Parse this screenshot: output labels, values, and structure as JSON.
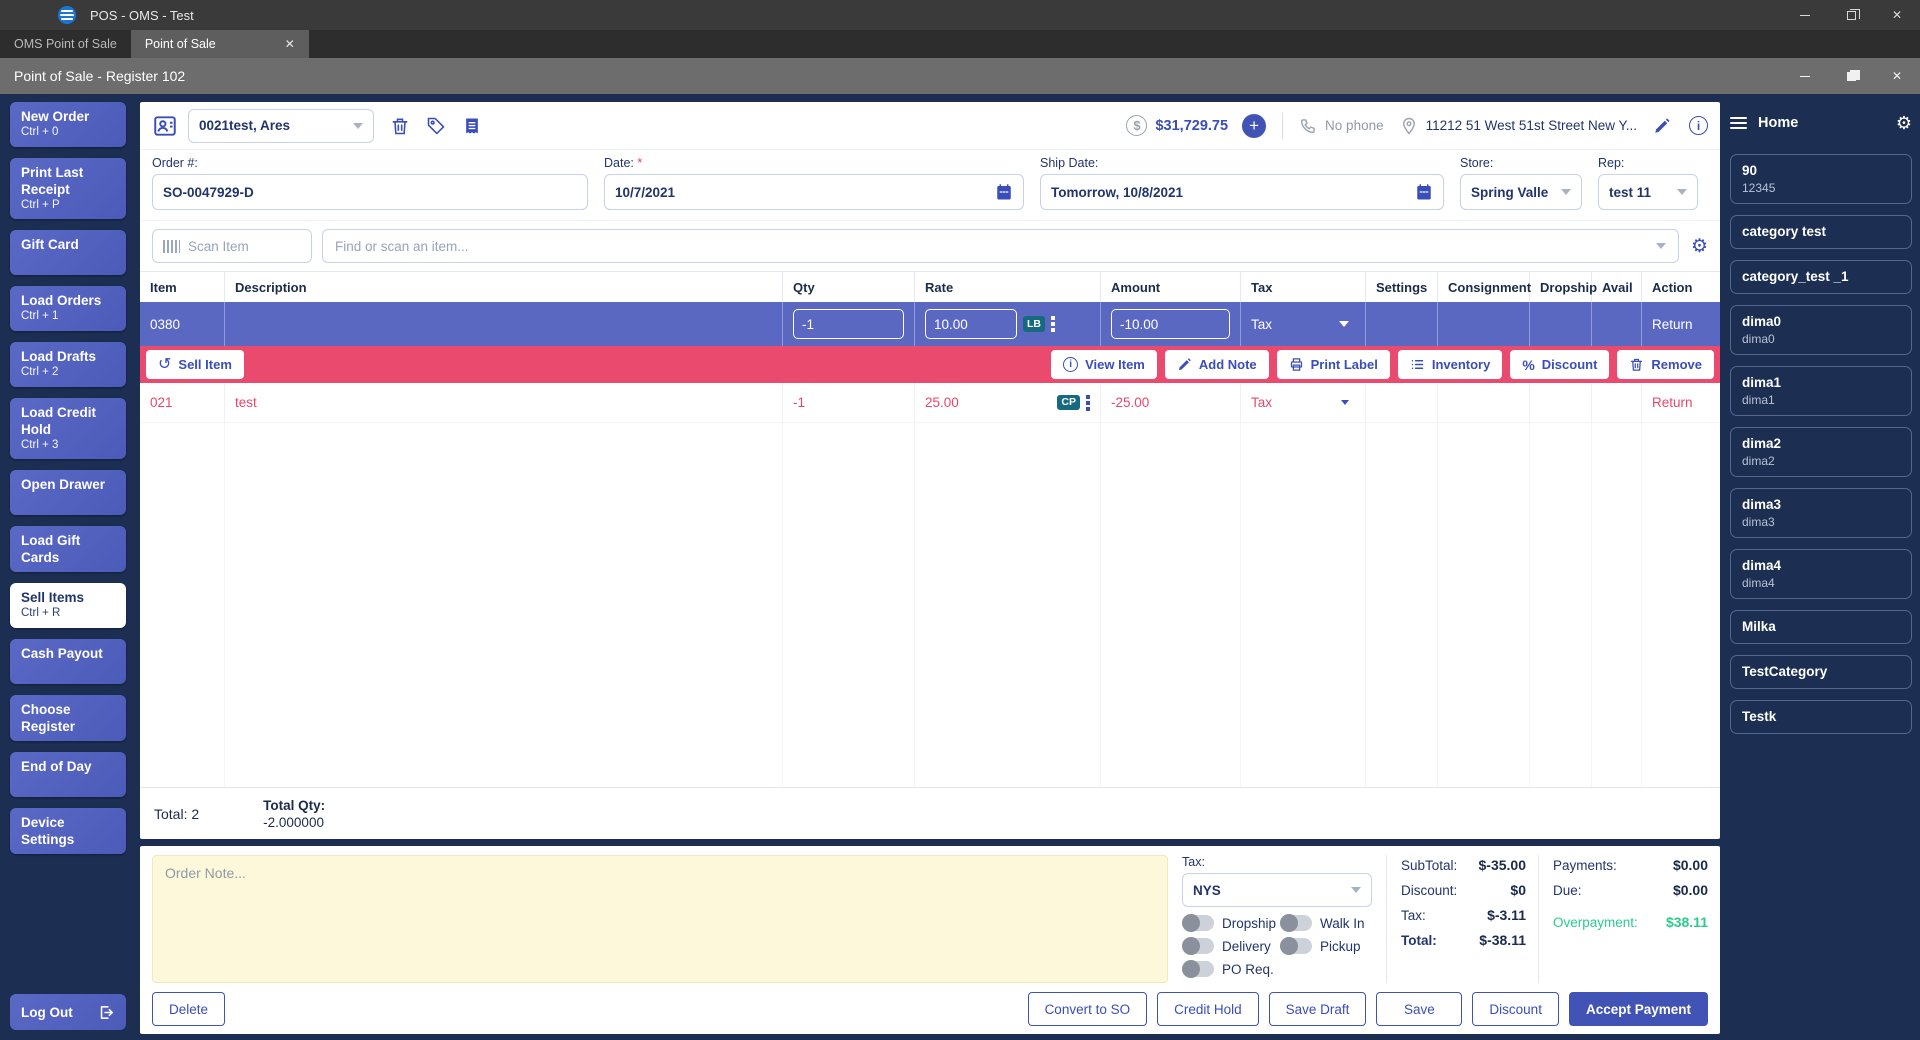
{
  "window": {
    "title": "POS - OMS - Test",
    "tab1": "OMS Point of Sale",
    "tab2": "Point of Sale",
    "register_title": "Point of Sale - Register 102"
  },
  "sidebar": {
    "items": [
      {
        "label": "New Order",
        "shortcut": "Ctrl + 0"
      },
      {
        "label": "Print Last Receipt",
        "shortcut": "Ctrl + P"
      },
      {
        "label": "Gift Card",
        "shortcut": ""
      },
      {
        "label": "Load Orders",
        "shortcut": "Ctrl + 1"
      },
      {
        "label": "Load Drafts",
        "shortcut": "Ctrl + 2"
      },
      {
        "label": "Load Credit Hold",
        "shortcut": "Ctrl + 3"
      },
      {
        "label": "Open Drawer",
        "shortcut": ""
      },
      {
        "label": "Load Gift Cards",
        "shortcut": ""
      },
      {
        "label": "Sell Items",
        "shortcut": "Ctrl + R"
      },
      {
        "label": "Cash Payout",
        "shortcut": ""
      },
      {
        "label": "Choose Register",
        "shortcut": ""
      },
      {
        "label": "End of Day",
        "shortcut": ""
      },
      {
        "label": "Device Settings",
        "shortcut": ""
      }
    ],
    "logout": "Log Out"
  },
  "customer_bar": {
    "customer": "0021test, Ares",
    "balance": "$31,729.75",
    "phone": "No phone",
    "address": "11212 51 West 51st Street New Y..."
  },
  "fields": {
    "order_label": "Order #:",
    "order_value": "SO-0047929-D",
    "date_label": "Date:",
    "date_value": "10/7/2021",
    "ship_label": "Ship Date:",
    "ship_value": "Tomorrow, 10/8/2021",
    "store_label": "Store:",
    "store_value": "Spring Valle",
    "rep_label": "Rep:",
    "rep_value": "test 11"
  },
  "scan": {
    "scan_placeholder": "Scan Item",
    "find_placeholder": "Find or scan an item..."
  },
  "table": {
    "headers": [
      "Item",
      "Description",
      "Qty",
      "Rate",
      "Amount",
      "Tax",
      "Settings",
      "Consignment",
      "Dropship",
      "Avail",
      "Action"
    ],
    "selected_row": {
      "item": "0380",
      "description": "",
      "qty": "-1",
      "rate": "10.00",
      "badge": "LB",
      "amount": "-10.00",
      "tax": "Tax",
      "action": "Return"
    },
    "row2": {
      "item": "021",
      "description": "test",
      "qty": "-1",
      "rate": "25.00",
      "badge": "CP",
      "amount": "-25.00",
      "tax": "Tax",
      "action": "Return"
    }
  },
  "row_actions": {
    "sell": "Sell Item",
    "view": "View Item",
    "add_note": "Add Note",
    "print_label": "Print Label",
    "inventory": "Inventory",
    "discount": "Discount",
    "remove": "Remove"
  },
  "totals": {
    "total_label": "Total:",
    "total_value": "2",
    "qty_label": "Total Qty:",
    "qty_value": "-2.000000"
  },
  "footer": {
    "note_placeholder": "Order Note...",
    "tax_label": "Tax:",
    "tax_value": "NYS",
    "toggles": [
      "Dropship",
      "Walk In",
      "Delivery",
      "Pickup",
      "PO Req."
    ],
    "summary": [
      {
        "label": "SubTotal:",
        "value": "$-35.00"
      },
      {
        "label": "Discount:",
        "value": "$0"
      },
      {
        "label": "Tax:",
        "value": "$-3.11"
      },
      {
        "label": "Total:",
        "value": "$-38.11"
      }
    ],
    "payments": [
      {
        "label": "Payments:",
        "value": "$0.00"
      },
      {
        "label": "Due:",
        "value": "$0.00"
      },
      {
        "label": "Overpayment:",
        "value": "$38.11"
      }
    ],
    "buttons": {
      "delete": "Delete",
      "convert": "Convert to SO",
      "credit_hold": "Credit Hold",
      "save_draft": "Save Draft",
      "save": "Save",
      "discount": "Discount",
      "accept": "Accept Payment"
    }
  },
  "right_panel": {
    "title": "Home",
    "categories": [
      {
        "name": "90",
        "sub": "12345"
      },
      {
        "name": "category test",
        "sub": ""
      },
      {
        "name": "category_test _1",
        "sub": ""
      },
      {
        "name": "dima0",
        "sub": "dima0"
      },
      {
        "name": "dima1",
        "sub": "dima1"
      },
      {
        "name": "dima2",
        "sub": "dima2"
      },
      {
        "name": "dima3",
        "sub": "dima3"
      },
      {
        "name": "dima4",
        "sub": "dima4"
      },
      {
        "name": "Milka",
        "sub": ""
      },
      {
        "name": "TestCategory",
        "sub": ""
      },
      {
        "name": "Testk",
        "sub": ""
      }
    ]
  },
  "colors": {
    "accent_blue": "#4053b8",
    "selected_row_blue": "#5b68c2",
    "action_bar_red": "#e94a6e",
    "badge_teal": "#156a80",
    "overpayment_green": "#2bcb8c",
    "background_navy": "#1c2e52",
    "note_yellow": "#fdf8da"
  }
}
